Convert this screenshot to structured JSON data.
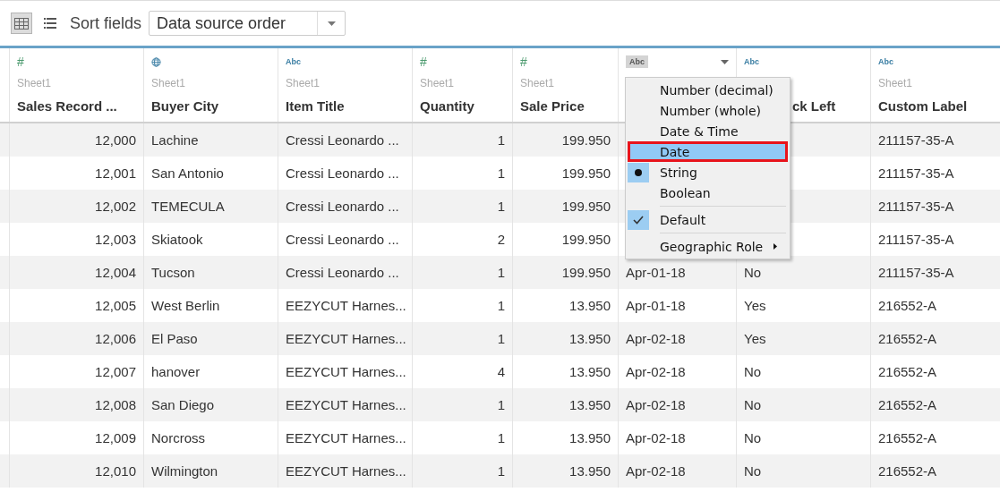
{
  "toolbar": {
    "views": [
      {
        "kind": "grid",
        "selected": true
      },
      {
        "kind": "list",
        "selected": false
      }
    ],
    "sort_label": "Sort fields",
    "sort_value": "Data source order"
  },
  "columns": [
    {
      "kind": "number",
      "type_label": "#",
      "sheet": "Sheet1",
      "name": "Sales Record ...",
      "active": false
    },
    {
      "kind": "geo",
      "sheet": "Sheet1",
      "name": "Buyer City",
      "active": false
    },
    {
      "kind": "string",
      "type_label": "Abc",
      "sheet": "Sheet1",
      "name": "Item Title",
      "active": false
    },
    {
      "kind": "number",
      "type_label": "#",
      "sheet": "Sheet1",
      "name": "Quantity",
      "active": false
    },
    {
      "kind": "number",
      "type_label": "#",
      "sheet": "Sheet1",
      "name": "Sale Price",
      "active": false
    },
    {
      "kind": "string",
      "type_label": "Abc",
      "active": true
    },
    {
      "kind": "string",
      "type_label": "Abc",
      "name": "ck Left",
      "active": false
    },
    {
      "kind": "string",
      "type_label": "Abc",
      "sheet": "Sheet1",
      "name": "Custom Label",
      "active": false
    }
  ],
  "rows": [
    [
      "12,000",
      "Lachine",
      "Cressi Leonardo ...",
      "1",
      "199.950",
      null,
      null,
      "211157-35-A"
    ],
    [
      "12,001",
      "San Antonio",
      "Cressi Leonardo ...",
      "1",
      "199.950",
      null,
      null,
      "211157-35-A"
    ],
    [
      "12,002",
      "TEMECULA",
      "Cressi Leonardo ...",
      "1",
      "199.950",
      null,
      null,
      "211157-35-A"
    ],
    [
      "12,003",
      "Skiatook",
      "Cressi Leonardo ...",
      "2",
      "199.950",
      null,
      null,
      "211157-35-A"
    ],
    [
      "12,004",
      "Tucson",
      "Cressi Leonardo ...",
      "1",
      "199.950",
      "Apr-01-18",
      "No",
      "211157-35-A"
    ],
    [
      "12,005",
      "West Berlin",
      "EEZYCUT Harnes...",
      "1",
      "13.950",
      "Apr-01-18",
      "Yes",
      "216552-A"
    ],
    [
      "12,006",
      "El Paso",
      "EEZYCUT Harnes...",
      "1",
      "13.950",
      "Apr-02-18",
      "Yes",
      "216552-A"
    ],
    [
      "12,007",
      "hanover",
      "EEZYCUT Harnes...",
      "4",
      "13.950",
      "Apr-02-18",
      "No",
      "216552-A"
    ],
    [
      "12,008",
      "San Diego",
      "EEZYCUT Harnes...",
      "1",
      "13.950",
      "Apr-02-18",
      "No",
      "216552-A"
    ],
    [
      "12,009",
      "Norcross",
      "EEZYCUT Harnes...",
      "1",
      "13.950",
      "Apr-02-18",
      "No",
      "216552-A"
    ],
    [
      "12,010",
      "Wilmington",
      "EEZYCUT Harnes...",
      "1",
      "13.950",
      "Apr-02-18",
      "No",
      "216552-A"
    ]
  ],
  "menu": {
    "items": [
      {
        "kind": "item",
        "label": "Number (decimal)",
        "selected": false,
        "highlighted": false
      },
      {
        "kind": "item",
        "label": "Number (whole)",
        "selected": false,
        "highlighted": false
      },
      {
        "kind": "item",
        "label": "Date & Time",
        "selected": false,
        "highlighted": false
      },
      {
        "kind": "item",
        "label": "Date",
        "selected": false,
        "highlighted": true
      },
      {
        "kind": "item",
        "label": "String",
        "selected": true,
        "highlighted": false
      },
      {
        "kind": "item",
        "label": "Boolean",
        "selected": false,
        "highlighted": false
      },
      {
        "kind": "separator"
      },
      {
        "kind": "check",
        "label": "Default",
        "checked": true
      },
      {
        "kind": "separator"
      },
      {
        "kind": "submenu",
        "label": "Geographic Role"
      }
    ]
  }
}
